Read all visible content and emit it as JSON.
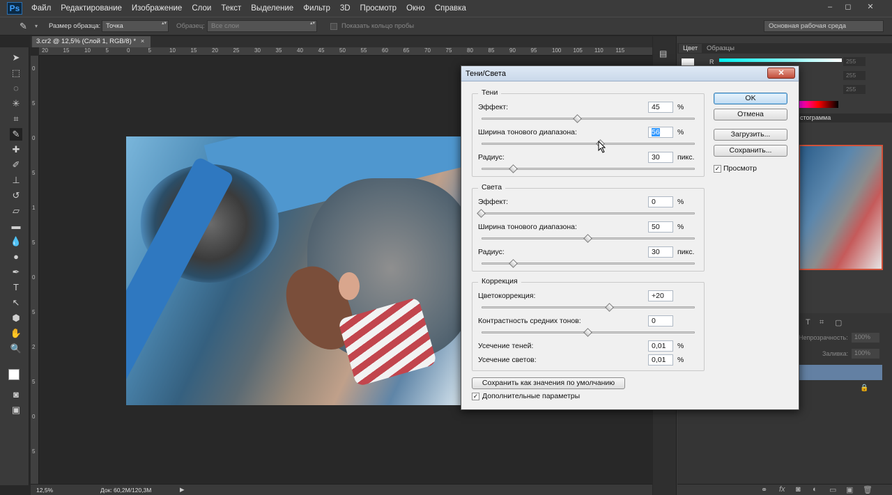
{
  "app": {
    "logo": "Ps"
  },
  "menu": [
    "Файл",
    "Редактирование",
    "Изображение",
    "Слои",
    "Текст",
    "Выделение",
    "Фильтр",
    "3D",
    "Просмотр",
    "Окно",
    "Справка"
  ],
  "window_controls": [
    "‒",
    "◻",
    "✕"
  ],
  "options_bar": {
    "sample_size_label": "Размер образца:",
    "sample_size_value": "Точка",
    "sample_label": "Образец:",
    "sample_value": "Все слои",
    "show_ring_label": "Показать кольцо пробы",
    "workspace": "Основная рабочая среда"
  },
  "document": {
    "tab_title": "3.cr2 @ 12,5% (Слой 1, RGB/8) *",
    "ruler_top": [
      "20",
      "15",
      "10",
      "5",
      "0",
      "5",
      "10",
      "15",
      "20",
      "25",
      "30",
      "35",
      "40",
      "45",
      "50",
      "55",
      "60",
      "65",
      "70",
      "75",
      "80",
      "85",
      "90",
      "95",
      "100",
      "105",
      "110",
      "115"
    ],
    "ruler_left": [
      "0",
      "5",
      "0",
      "5",
      "1",
      "5",
      "0",
      "5",
      "2",
      "5",
      "0",
      "5"
    ]
  },
  "status": {
    "zoom": "12,5%",
    "doc": "Док: 60,2M/120,3M"
  },
  "panels": {
    "color_tab": "Цвет",
    "swatches_tab": "Образцы",
    "histogram_tab": "стограмма",
    "opacity_label": "Непрозрачность:",
    "opacity_value": "100%",
    "fill_label": "Заливка:",
    "fill_value": "100%",
    "channel_r": "R",
    "channel_value": "255"
  },
  "dialog": {
    "title": "Тени/Света",
    "shadows": {
      "title": "Тени",
      "effect_label": "Эффект:",
      "effect_value": "45",
      "effect_unit": "%",
      "effect_pct": 0.45,
      "width_label": "Ширина тонового диапазона:",
      "width_value": "56",
      "width_unit": "%",
      "width_pct": 0.56,
      "radius_label": "Радиус:",
      "radius_value": "30",
      "radius_unit": "пикс.",
      "radius_pct": 0.15
    },
    "highlights": {
      "title": "Света",
      "effect_label": "Эффект:",
      "effect_value": "0",
      "effect_unit": "%",
      "effect_pct": 0.0,
      "width_label": "Ширина тонового диапазона:",
      "width_value": "50",
      "width_unit": "%",
      "width_pct": 0.5,
      "radius_label": "Радиус:",
      "radius_value": "30",
      "radius_unit": "пикс.",
      "radius_pct": 0.15
    },
    "correction": {
      "title": "Коррекция",
      "color_label": "Цветокоррекция:",
      "color_value": "+20",
      "color_pct": 0.6,
      "midtone_label": "Контрастность средних тонов:",
      "midtone_value": "0",
      "midtone_pct": 0.5,
      "clip_shadows_label": "Усечение теней:",
      "clip_shadows_value": "0,01",
      "clip_shadows_unit": "%",
      "clip_highlights_label": "Усечение светов:",
      "clip_highlights_value": "0,01",
      "clip_highlights_unit": "%"
    },
    "buttons": {
      "ok": "OK",
      "cancel": "Отмена",
      "load": "Загрузить...",
      "save": "Сохранить...",
      "save_default": "Сохранить как значения по умолчанию"
    },
    "preview_label": "Просмотр",
    "preview_checked": true,
    "more_options_label": "Дополнительные параметры",
    "more_options_checked": true
  }
}
